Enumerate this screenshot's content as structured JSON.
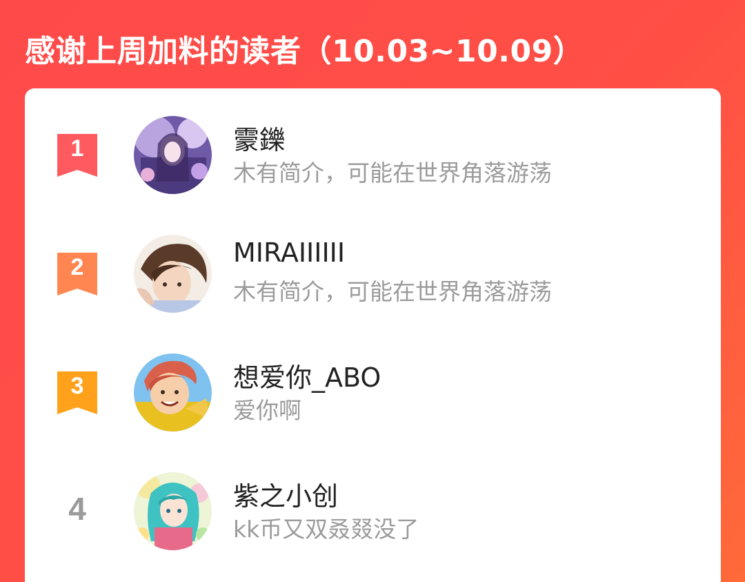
{
  "header": {
    "title": "感谢上周加料的读者（10.03~10.09）"
  },
  "colors": {
    "background_start": "#ff4a4a",
    "background_end": "#ff6a3a",
    "rank1": "#ff5a5f",
    "rank2": "#ff8650",
    "rank3": "#ffa11a",
    "rank_plain": "#9a9a9a"
  },
  "readers": [
    {
      "rank": "1",
      "name": "霥鑠",
      "bio": "木有简介，可能在世界角落游荡",
      "avatar_icon": "anime-avatar-purple-icon"
    },
    {
      "rank": "2",
      "name": "MIRAIIIIII",
      "bio": "木有简介，可能在世界角落游荡",
      "avatar_icon": "anime-avatar-brown-hair-icon"
    },
    {
      "rank": "3",
      "name": "想爱你_ABO",
      "bio": "爱你啊",
      "avatar_icon": "anime-avatar-yellow-shirt-icon"
    },
    {
      "rank": "4",
      "name": "紫之小创",
      "bio": "kk币又双叒叕没了",
      "avatar_icon": "anime-avatar-teal-hair-icon"
    }
  ]
}
